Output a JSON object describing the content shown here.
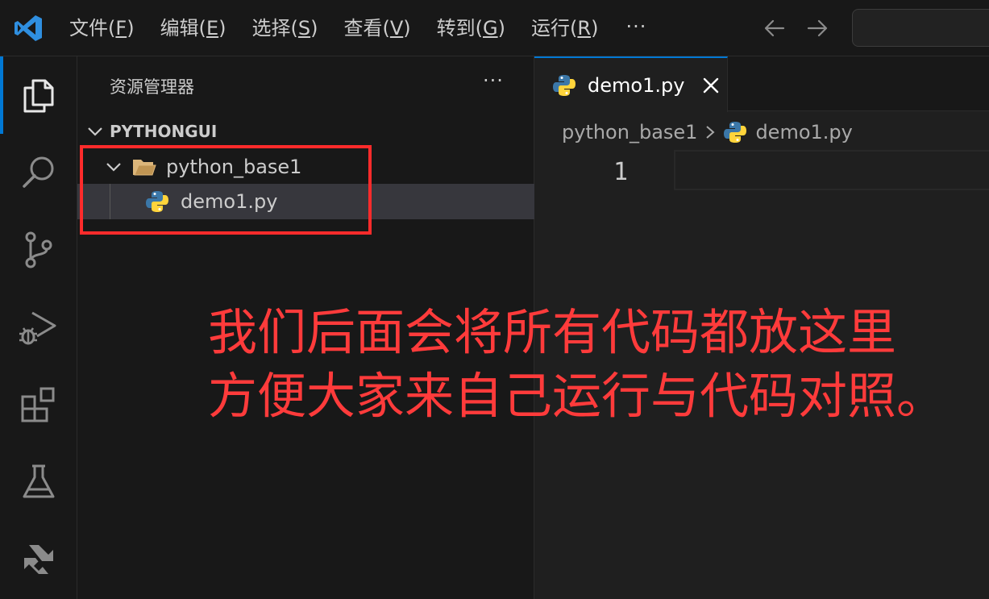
{
  "menu": {
    "items": [
      {
        "label": "文件(",
        "key": "F",
        "end": ")"
      },
      {
        "label": "编辑(",
        "key": "E",
        "end": ")"
      },
      {
        "label": "选择(",
        "key": "S",
        "end": ")"
      },
      {
        "label": "查看(",
        "key": "V",
        "end": ")"
      },
      {
        "label": "转到(",
        "key": "G",
        "end": ")"
      },
      {
        "label": "运行(",
        "key": "R",
        "end": ")"
      }
    ],
    "more": "···"
  },
  "activity_bar": {
    "items": [
      "explorer-icon",
      "search-icon",
      "source-control-icon",
      "run-debug-icon",
      "extensions-icon",
      "testing-icon",
      "marscode-icon"
    ],
    "active": "explorer-icon",
    "accent_color": "#0078d4"
  },
  "sidebar": {
    "title": "资源管理器",
    "more": "···",
    "section": "PYTHONGUI",
    "folder": "python_base1",
    "file": "demo1.py"
  },
  "editor": {
    "tab_label": "demo1.py",
    "breadcrumb": {
      "folder": "python_base1",
      "file": "demo1.py"
    },
    "line_number": "1"
  },
  "annotation": {
    "line1": "我们后面会将所有代码都放这里",
    "line2": "方便大家来自己运行与代码对照。",
    "color": "#ff3b3b"
  }
}
